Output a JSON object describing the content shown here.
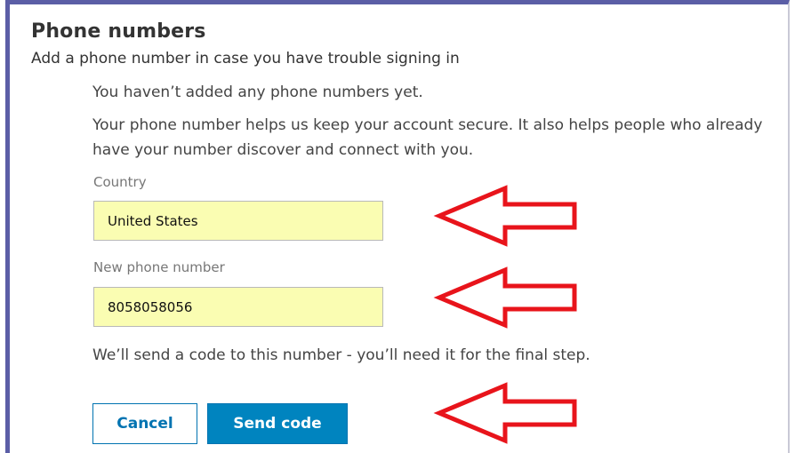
{
  "section": {
    "title": "Phone numbers",
    "subtitle": "Add a phone number in case you have trouble signing in",
    "empty_message": "You haven’t added any phone numbers yet.",
    "help_message": "Your phone number helps us keep your account secure. It also helps people who already have your number discover and connect with you."
  },
  "form": {
    "country_label": "Country",
    "country_value": "United States",
    "phone_label": "New phone number",
    "phone_value": "8058058056",
    "notice": "We’ll send a code to this number - you’ll need it for the final step."
  },
  "buttons": {
    "cancel_label": "Cancel",
    "send_label": "Send code"
  },
  "annotations": {
    "arrow_color": "#e8141b",
    "arrow_icon": "left-arrow-outline"
  },
  "colors": {
    "accent": "#0073b1",
    "primary_button": "#0084bf",
    "autofill_background": "#fafdb2",
    "frame": "#5b5ea6"
  }
}
